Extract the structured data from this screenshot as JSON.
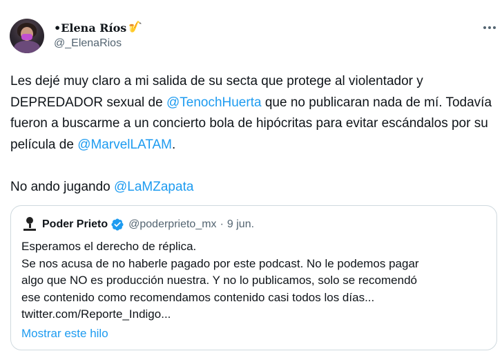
{
  "author": {
    "display_name": "•Elena Ríos",
    "emoji": "🎷",
    "handle": "@_ElenaRios"
  },
  "tweet": {
    "p1": "Les dejé muy claro a mi salida de su secta que protege al violentador y DEPREDADOR sexual de ",
    "mention1": "@TenochHuerta",
    "p2": " que no publicaran nada de mí. Todavía fueron a buscarme a un concierto bola de hipócritas para evitar escándalos por su película de ",
    "mention2": "@MarvelLATAM",
    "p3": ".\n\nNo ando jugando ",
    "mention3": "@LaMZapata"
  },
  "quote": {
    "name": "Poder Prieto",
    "handle": "@poderprieto_mx",
    "separator": "·",
    "date": "9 jun.",
    "lines": [
      "Esperamos el derecho de réplica.",
      "Se nos acusa de no haberle pagado por este podcast. No le podemos pagar",
      "algo que NO es producción nuestra. Y no lo publicamos, solo se recomendó",
      "ese contenido como recomendamos contenido casi todos los días...",
      "twitter.com/Reporte_Indigo..."
    ],
    "show_thread": "Mostrar este hilo"
  },
  "colors": {
    "link": "#1d9bf0",
    "secondary_text": "#536471",
    "border": "#cfd9de",
    "verified": "#1d9bf0"
  },
  "icons": [
    "saxophone-emoji",
    "more-options-icon",
    "verified-badge-icon",
    "microphone-logo"
  ]
}
